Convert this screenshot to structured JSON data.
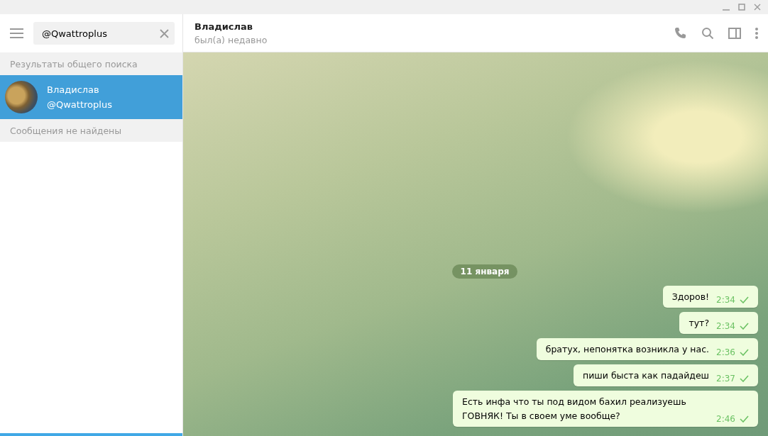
{
  "search": {
    "value": "@Qwattroplus"
  },
  "sections": [
    {
      "label": "Результаты общего поиска"
    },
    {
      "label": "Сообщения не найдены"
    }
  ],
  "results": [
    {
      "name": "Владислав",
      "username": "@Qwattroplus",
      "selected": true
    }
  ],
  "chat": {
    "title": "Владислав",
    "status": "был(а) недавно"
  },
  "date_pill": "11 января",
  "messages": [
    {
      "text": "Здоров!",
      "time": "2:34"
    },
    {
      "text": "тут?",
      "time": "2:34"
    },
    {
      "text": "братух, непонятка возникла у нас.",
      "time": "2:36"
    },
    {
      "text": "пиши быста как падайдеш",
      "time": "2:37"
    },
    {
      "text": "Есть инфа что ты под видом бахил реализуешь ГОВНЯК! Ты в своем уме вообще?",
      "time": "2:46"
    }
  ]
}
